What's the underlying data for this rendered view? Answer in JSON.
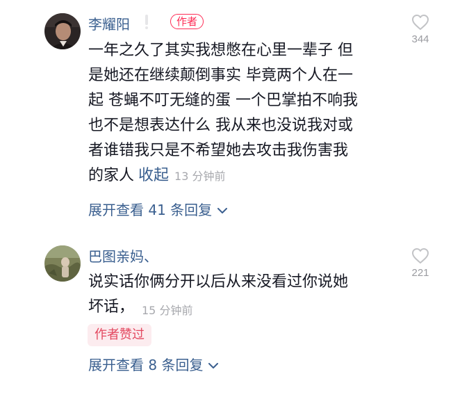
{
  "comments": [
    {
      "username": "李耀阳",
      "author_tag": "作者",
      "body_lines": [
        "一年之久了其实我想憋在心里一辈子 但",
        "是她还在继续颠倒事实 毕竟两个人在一",
        "起 苍蝇不叮无缝的蛋 一个巴掌拍不响我",
        "也不是想表达什么 我从来也没说我对或",
        "者谁错我只是不希望她去攻击我伤害我",
        "的家人"
      ],
      "collapse_label": "收起",
      "time": "13 分钟前",
      "likes": "344",
      "expand_label": "展开查看 41 条回复"
    },
    {
      "username": "巴图亲妈、",
      "body_lines": [
        "说实话你俩分开以后从来没看过你说她",
        "坏话，"
      ],
      "time": "15 分钟前",
      "likes": "221",
      "liked_badge": "作者赞过",
      "expand_label": "展开查看 8 条回复"
    }
  ],
  "colors": {
    "link_blue": "#3a5f8f",
    "author_red": "#fe2c55",
    "muted_gray": "#a7a8ad"
  },
  "icons": {
    "like": "heart-outline-icon",
    "expand": "chevron-down-icon"
  }
}
